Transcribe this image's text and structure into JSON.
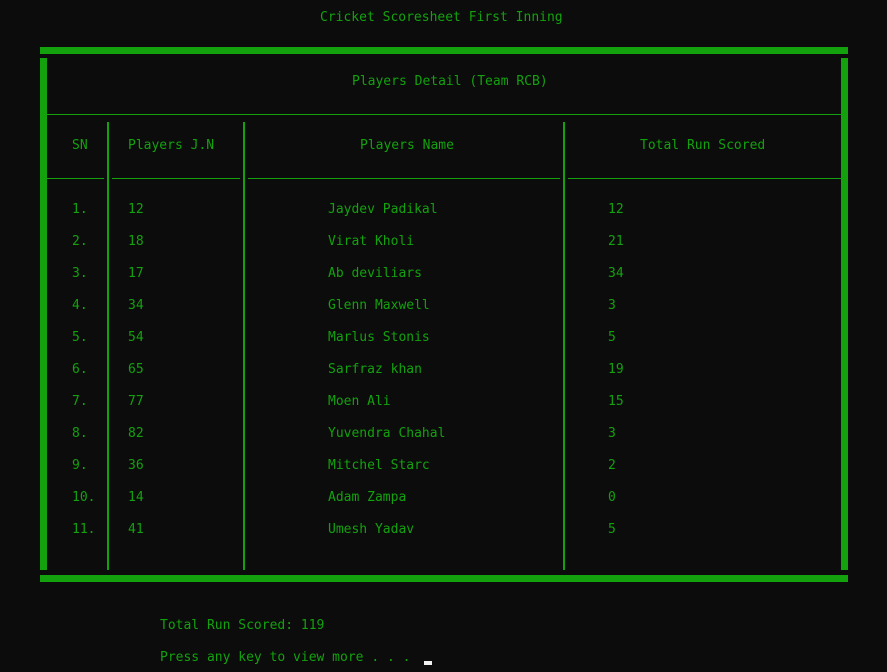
{
  "title": "Cricket Scoresheet First Inning",
  "table_title": "Players Detail (Team RCB)",
  "headers": {
    "sn": "SN",
    "jn": "Players J.N",
    "name": "Players Name",
    "runs": "Total Run Scored"
  },
  "rows": [
    {
      "sn": "1.",
      "jn": "12",
      "name": "Jaydev Padikal",
      "runs": "12"
    },
    {
      "sn": "2.",
      "jn": "18",
      "name": "Virat Kholi",
      "runs": "21"
    },
    {
      "sn": "3.",
      "jn": "17",
      "name": "Ab deviliars",
      "runs": "34"
    },
    {
      "sn": "4.",
      "jn": "34",
      "name": "Glenn Maxwell",
      "runs": "3"
    },
    {
      "sn": "5.",
      "jn": "54",
      "name": "Marlus Stonis",
      "runs": "5"
    },
    {
      "sn": "6.",
      "jn": "65",
      "name": "Sarfraz khan",
      "runs": "19"
    },
    {
      "sn": "7.",
      "jn": "77",
      "name": "Moen Ali",
      "runs": "15"
    },
    {
      "sn": "8.",
      "jn": "82",
      "name": "Yuvendra Chahal",
      "runs": "3"
    },
    {
      "sn": "9.",
      "jn": "36",
      "name": "Mitchel Starc",
      "runs": "2"
    },
    {
      "sn": "10.",
      "jn": "14",
      "name": "Adam Zampa",
      "runs": "0"
    },
    {
      "sn": "11.",
      "jn": "41",
      "name": "Umesh Yadav",
      "runs": "5"
    }
  ],
  "total_line": "Total Run Scored: 119",
  "prompt": "Press any key to view more . . .",
  "colors": {
    "text": "#13a10e",
    "background": "#0c0c0c",
    "cursor": "#f0f0f0"
  }
}
